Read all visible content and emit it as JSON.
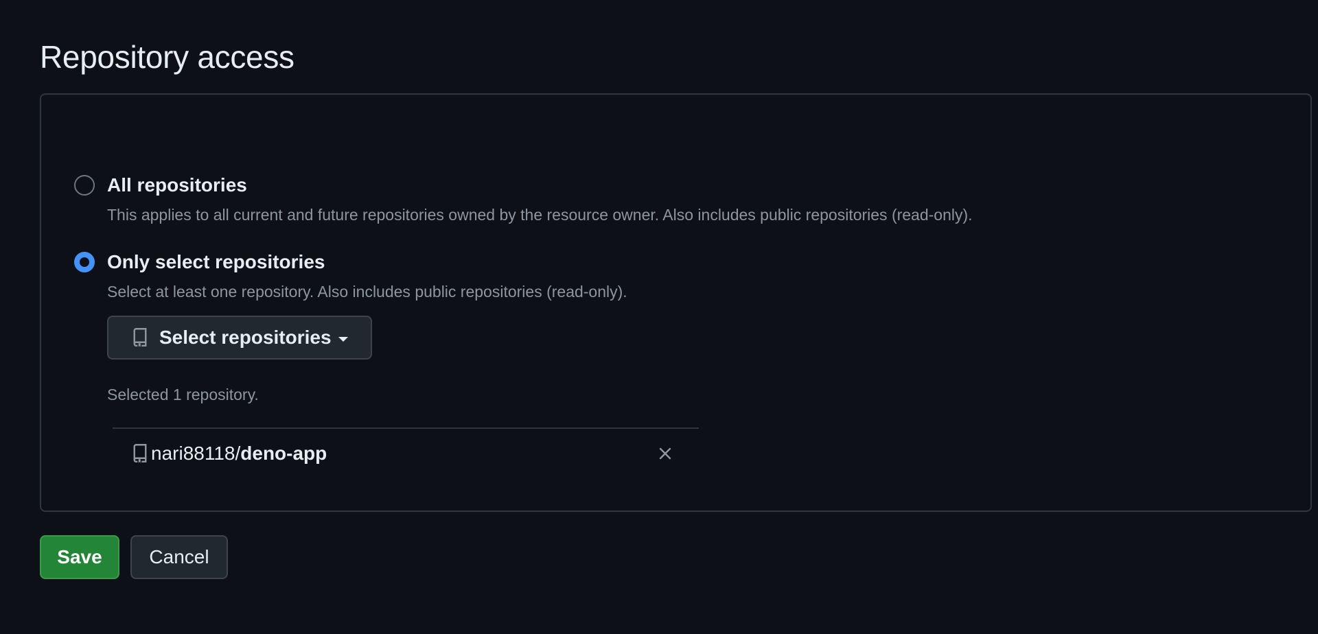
{
  "section": {
    "title": "Repository access"
  },
  "options": {
    "all": {
      "label": "All repositories",
      "description": "This applies to all current and future repositories owned by the resource owner. Also includes public repositories (read-only).",
      "checked": false
    },
    "select": {
      "label": "Only select repositories",
      "description": "Select at least one repository. Also includes public repositories (read-only).",
      "checked": true
    }
  },
  "select_button": {
    "label": "Select repositories",
    "icon": "repo-icon"
  },
  "selected_count": "Selected 1 repository.",
  "repositories": [
    {
      "owner": "nari88118",
      "separator": "/",
      "name": "deno-app"
    }
  ],
  "actions": {
    "save_label": "Save",
    "cancel_label": "Cancel"
  },
  "colors": {
    "background": "#0d1117",
    "accent": "#4493f8",
    "save": "#238636",
    "border": "#30363d"
  }
}
